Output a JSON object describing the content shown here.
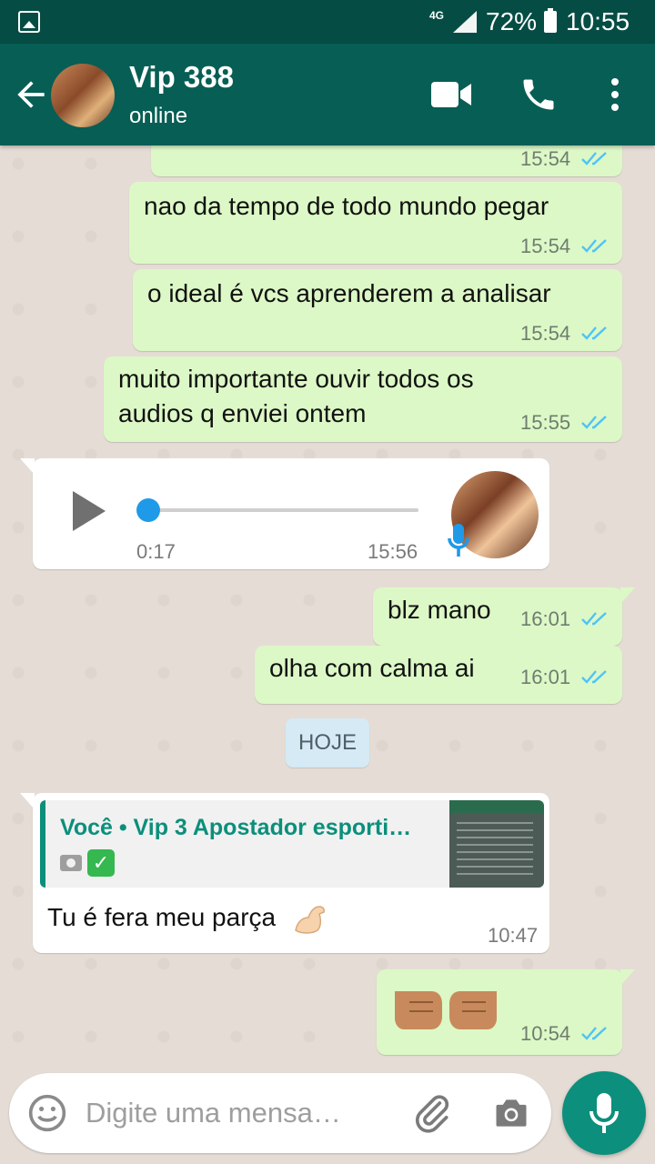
{
  "status_bar": {
    "network": "4G",
    "battery": "72%",
    "time": "10:55"
  },
  "header": {
    "contact_name": "Vip 388",
    "status": "online"
  },
  "messages": [
    {
      "dir": "out",
      "text": "",
      "time": "15:54"
    },
    {
      "dir": "out",
      "text": "nao da tempo de todo mundo pegar",
      "time": "15:54"
    },
    {
      "dir": "out",
      "text": "o ideal é vcs aprenderem a analisar",
      "time": "15:54"
    },
    {
      "dir": "out",
      "line1": "muito importante ouvir todos os",
      "line2": "audios q enviei ontem",
      "time": "15:55"
    },
    {
      "dir": "in",
      "type": "audio",
      "duration": "0:17",
      "time": "15:56",
      "progress": 0.0
    },
    {
      "dir": "out",
      "text": "blz mano",
      "time": "16:01"
    },
    {
      "dir": "out",
      "text": "olha com calma ai",
      "time": "16:01"
    },
    {
      "dir": "in",
      "type": "reply",
      "quote_author": "Você • Vip 3 Apostador esporti…",
      "text": "Tu é fera meu parça",
      "time": "10:47"
    },
    {
      "dir": "out",
      "type": "emoji",
      "time": "10:54"
    }
  ],
  "date_divider": "HOJE",
  "composer": {
    "placeholder": "Digite uma mensa…"
  },
  "colors": {
    "header": "#075e54",
    "statusbar": "#054d44",
    "outgoing": "#dcf8c6",
    "incoming": "#ffffff",
    "accent": "#0c8f7c",
    "read_ticks": "#4fc3f7"
  }
}
